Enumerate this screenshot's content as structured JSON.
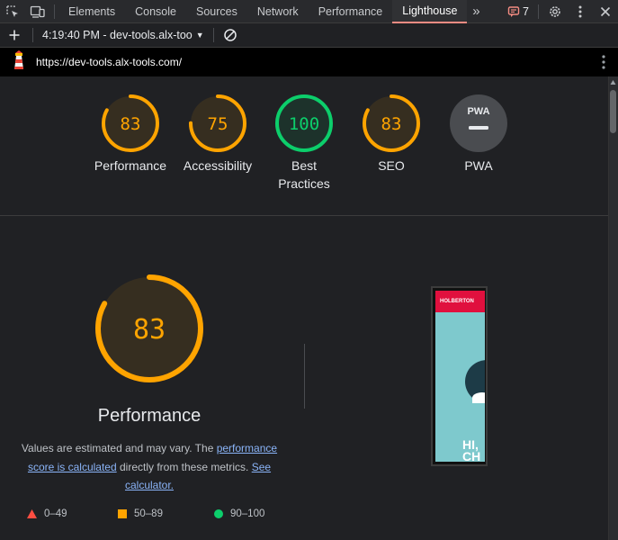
{
  "tabs": {
    "items": [
      {
        "label": "Elements"
      },
      {
        "label": "Console"
      },
      {
        "label": "Sources"
      },
      {
        "label": "Network"
      },
      {
        "label": "Performance"
      },
      {
        "label": "Lighthouse"
      }
    ],
    "active": "Lighthouse",
    "more_label": "»",
    "issues_count": "7"
  },
  "toolbar": {
    "report_label": "4:19:40 PM - dev-tools.alx-too"
  },
  "urlbar": {
    "url": "https://dev-tools.alx-tools.com/"
  },
  "scores": [
    {
      "label": "Performance",
      "value": "83",
      "score": 83,
      "status": "average"
    },
    {
      "label": "Accessibility",
      "value": "75",
      "score": 75,
      "status": "average"
    },
    {
      "label": "Best\nPractices",
      "value": "100",
      "score": 100,
      "status": "pass"
    },
    {
      "label": "SEO",
      "value": "83",
      "score": 83,
      "status": "average"
    },
    {
      "label": "PWA",
      "value": "PWA",
      "status": "na"
    }
  ],
  "performance": {
    "score": "83",
    "score_value": 83,
    "title": "Performance",
    "desc_prefix": "Values are estimated and may vary. The ",
    "desc_link1": "performance score is calculated",
    "desc_mid": " directly from these metrics. ",
    "desc_link2": "See calculator."
  },
  "legend": {
    "fail": "0–49",
    "average": "50–89",
    "pass": "90–100"
  },
  "screenshot": {
    "header_text": "HOLBERTON",
    "hero_text_line1": "HI,",
    "hero_text_line2": "CH"
  },
  "colors": {
    "average": "#ffa400",
    "pass": "#0cce6b",
    "fail": "#ff4e42",
    "active_tab_underline": "#f28b82"
  }
}
